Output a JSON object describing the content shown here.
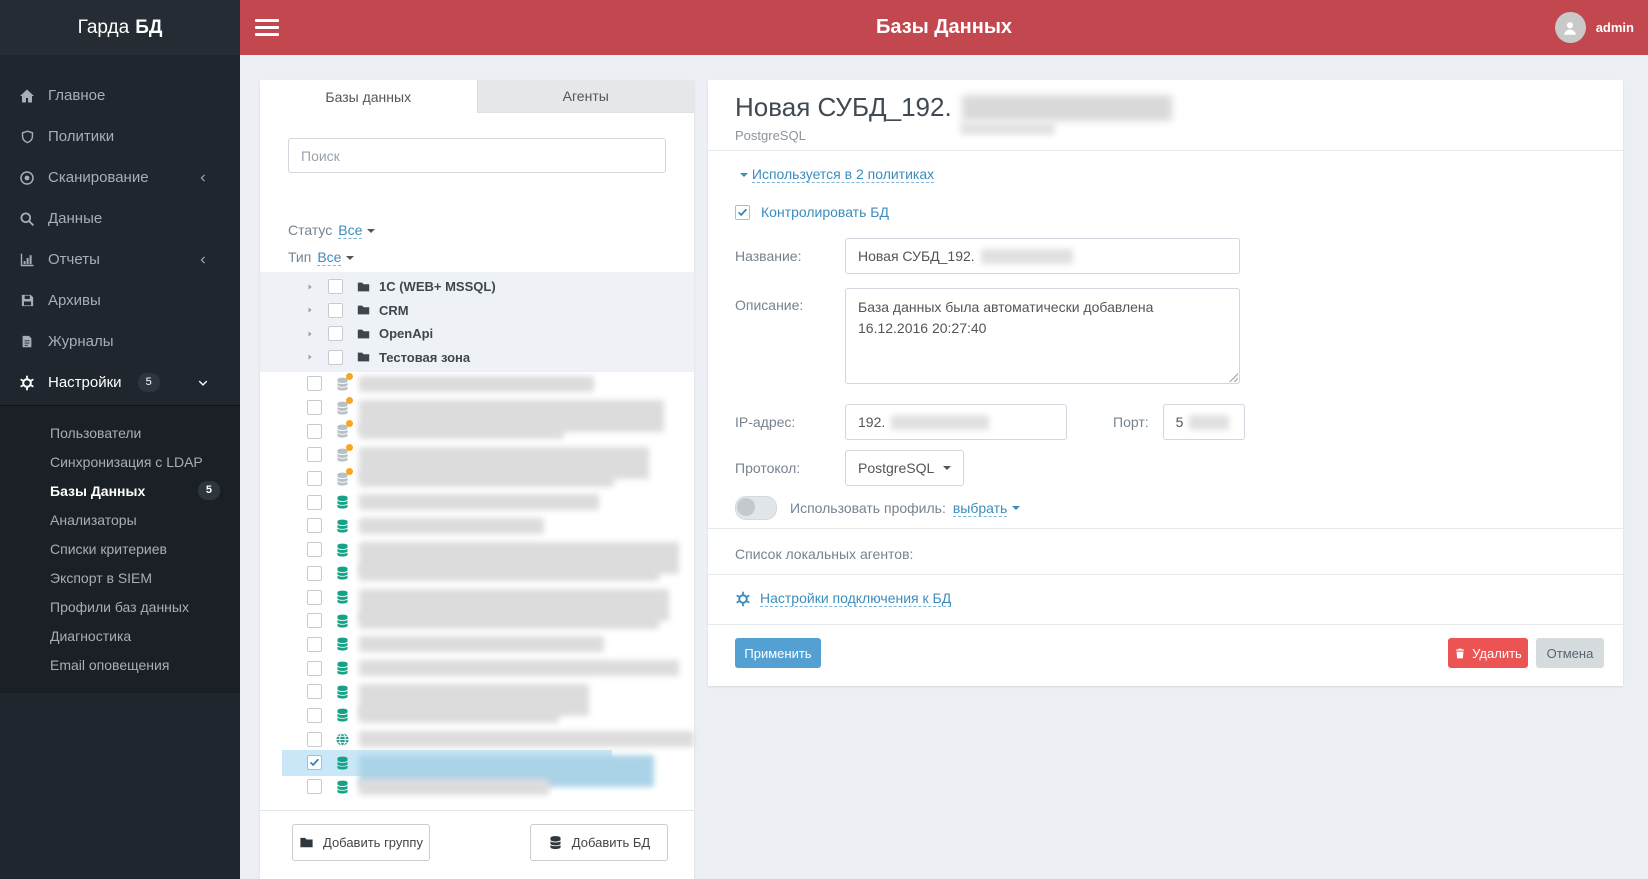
{
  "logo": {
    "text": "Гарда",
    "bold": "БД"
  },
  "topbar": {
    "title": "Базы Данных",
    "user": "admin"
  },
  "sidebar": {
    "items": [
      {
        "name": "home",
        "label": "Главное",
        "icon": "home"
      },
      {
        "name": "policies",
        "label": "Политики",
        "icon": "shield"
      },
      {
        "name": "scanning",
        "label": "Сканирование",
        "icon": "bullseye",
        "chevron": "left"
      },
      {
        "name": "data",
        "label": "Данные",
        "icon": "search"
      },
      {
        "name": "reports",
        "label": "Отчеты",
        "icon": "chart",
        "chevron": "left"
      },
      {
        "name": "archives",
        "label": "Архивы",
        "icon": "floppy"
      },
      {
        "name": "journals",
        "label": "Журналы",
        "icon": "file"
      },
      {
        "name": "settings",
        "label": "Настройки",
        "icon": "gear",
        "badge": "5",
        "chevron": "down",
        "active": true
      }
    ],
    "submenu": [
      {
        "name": "users",
        "label": "Пользователи"
      },
      {
        "name": "ldap-sync",
        "label": "Синхронизация с LDAP"
      },
      {
        "name": "databases",
        "label": "Базы Данных",
        "badge": "5",
        "active": true
      },
      {
        "name": "analyzers",
        "label": "Анализаторы"
      },
      {
        "name": "criteria-lists",
        "label": "Списки критериев"
      },
      {
        "name": "siem-export",
        "label": "Экспорт в SIEM"
      },
      {
        "name": "db-profiles",
        "label": "Профили баз данных"
      },
      {
        "name": "diagnostics",
        "label": "Диагностика"
      },
      {
        "name": "email-alerts",
        "label": "Email оповещения"
      }
    ]
  },
  "left_panel": {
    "tabs": [
      {
        "name": "databases",
        "label": "Базы данных",
        "active": true
      },
      {
        "name": "agents",
        "label": "Агенты",
        "active": false
      }
    ],
    "search_placeholder": "Поиск",
    "filters": [
      {
        "label": "Статус",
        "value": "Все"
      },
      {
        "label": "Тип",
        "value": "Все"
      }
    ],
    "folders": [
      {
        "label": "1С (WEB+ MSSQL)"
      },
      {
        "label": "CRM"
      },
      {
        "label": "OpenApi"
      },
      {
        "label": "Тестовая зона"
      }
    ],
    "db_rows": [
      {
        "icon": "db-orange",
        "redacted": true,
        "blur_w": 235
      },
      {
        "icon": "db-orange",
        "redacted": true,
        "blur_w": 305,
        "tall": true
      },
      {
        "icon": "db-orange",
        "redacted": true,
        "blur_w": 205
      },
      {
        "icon": "db-orange",
        "redacted": true,
        "blur_w": 290,
        "tall": true
      },
      {
        "icon": "db-orange",
        "redacted": true,
        "blur_w": 255
      },
      {
        "icon": "db-teal",
        "redacted": true,
        "blur_w": 240
      },
      {
        "icon": "db-teal",
        "redacted": true,
        "blur_w": 185
      },
      {
        "icon": "db-teal",
        "redacted": true,
        "blur_w": 320,
        "tall": true
      },
      {
        "icon": "db-teal",
        "redacted": true,
        "blur_w": 300
      },
      {
        "icon": "db-teal",
        "redacted": true,
        "blur_w": 310,
        "tall": true
      },
      {
        "icon": "db-teal",
        "redacted": true,
        "blur_w": 300
      },
      {
        "icon": "db-teal",
        "redacted": true,
        "blur_w": 245
      },
      {
        "icon": "db-teal",
        "redacted": true,
        "blur_w": 320
      },
      {
        "icon": "db-teal",
        "redacted": true,
        "blur_w": 230,
        "tall": true
      },
      {
        "icon": "db-teal",
        "redacted": true,
        "blur_w": 200
      },
      {
        "icon": "globe",
        "redacted": true,
        "blur_w": 370
      },
      {
        "icon": "db-teal",
        "redacted": true,
        "blur_w": 295,
        "tall": true,
        "selected": true,
        "checked": true
      },
      {
        "icon": "db-teal",
        "redacted": true,
        "blur_w": 190
      }
    ],
    "buttons": {
      "add_group": "Добавить группу",
      "add_db": "Добавить БД"
    }
  },
  "right_panel": {
    "title_prefix": "Новая СУБД_192.",
    "subtitle": "PostgreSQL",
    "policies_link": "Используется в 2 политиках",
    "control_label": "Контролировать БД",
    "form": {
      "name_label": "Название:",
      "name_value": "Новая СУБД_192.",
      "desc_label": "Описание:",
      "desc_value": "База данных была автоматически добавлена 16.12.2016 20:27:40",
      "ip_label": "IP-адрес:",
      "ip_value": "192.",
      "port_label": "Порт:",
      "port_value": "5",
      "protocol_label": "Протокол:",
      "protocol_value": "PostgreSQL",
      "profile_label": "Использовать профиль:",
      "profile_link": "выбрать"
    },
    "agents_label": "Список локальных агентов:",
    "connection_link": "Настройки подключения к БД",
    "buttons": {
      "apply": "Применить",
      "delete": "Удалить",
      "cancel": "Отмена"
    }
  },
  "colors": {
    "accent_red": "#c2474e",
    "link_blue": "#3c8dbc",
    "teal": "#16a286",
    "orange": "#f5a623",
    "apply_blue": "#54a0d3",
    "delete_red": "#ec5454",
    "sidebar_dark": "#20262e"
  }
}
